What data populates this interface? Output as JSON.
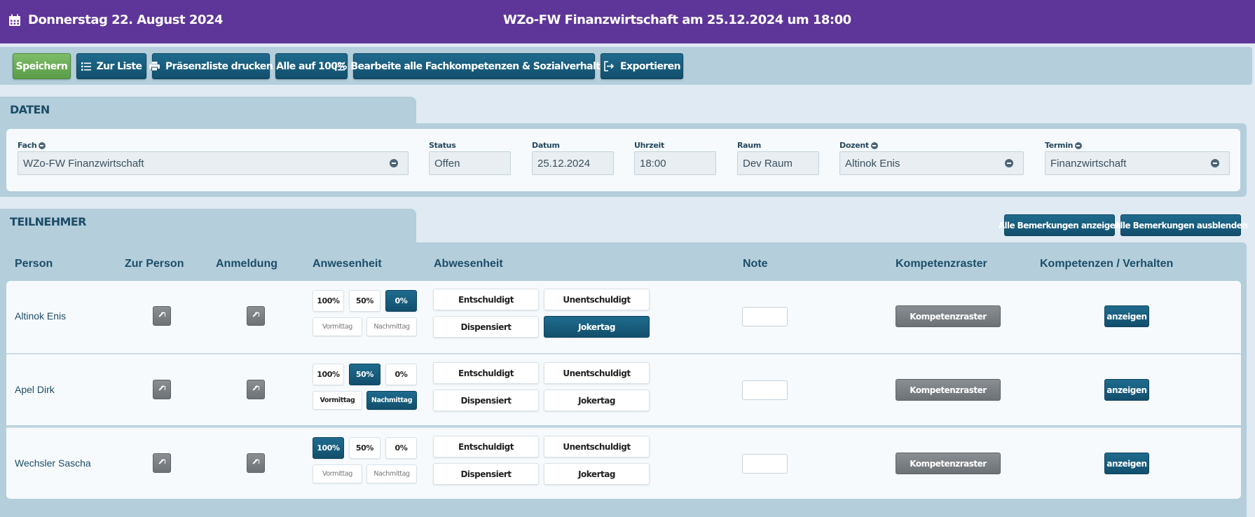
{
  "header": {
    "date": "Donnerstag 22. August 2024",
    "title": "WZo-FW Finanzwirtschaft am 25.12.2024 um 18:00"
  },
  "toolbar": {
    "save": "Speichern",
    "list": "Zur Liste",
    "print": "Präsenzliste drucken",
    "all100": "Alle auf 100%",
    "edit_all": "Bearbeite alle Fachkompetenzen & Sozialverhalten",
    "export": "Exportieren"
  },
  "daten": {
    "heading": "DATEN",
    "fach": {
      "label": "Fach",
      "value": "WZo-FW Finanzwirtschaft"
    },
    "status": {
      "label": "Status",
      "value": "Offen"
    },
    "datum": {
      "label": "Datum",
      "value": "25.12.2024"
    },
    "uhrzeit": {
      "label": "Uhrzeit",
      "value": "18:00"
    },
    "raum": {
      "label": "Raum",
      "value": "Dev Raum"
    },
    "dozent": {
      "label": "Dozent",
      "value": "Altinok Enis"
    },
    "termin": {
      "label": "Termin",
      "value": "Finanzwirtschaft"
    }
  },
  "teilnehmer": {
    "heading": "TEILNEHMER",
    "show_all": "Alle Bemerkungen anzeigen",
    "hide_all": "Alle Bemerkungen ausblenden",
    "columns": [
      "Person",
      "Zur Person",
      "Anmeldung",
      "Anwesenheit",
      "Abwesenheit",
      "Note",
      "Kompetenzraster",
      "Kompetenzen / Verhalten"
    ],
    "labels": {
      "p100": "100%",
      "p50": "50%",
      "p0": "0%",
      "vormittag": "Vormittag",
      "nachmittag": "Nachmittag",
      "entschuldigt": "Entschuldigt",
      "unentschuldigt": "Unentschuldigt",
      "dispensiert": "Dispensiert",
      "jokertag": "Jokertag",
      "kompetenzraster": "Kompetenzraster",
      "anzeigen": "anzeigen"
    },
    "rows": [
      {
        "name": "Altinok Enis",
        "presence": "0%",
        "half": "",
        "absence": "Jokertag",
        "note": ""
      },
      {
        "name": "Apel Dirk",
        "presence": "50%",
        "half": "Nachmittag",
        "absence": "",
        "note": ""
      },
      {
        "name": "Wechsler Sascha",
        "presence": "100%",
        "half": "",
        "absence": "",
        "note": ""
      }
    ]
  }
}
